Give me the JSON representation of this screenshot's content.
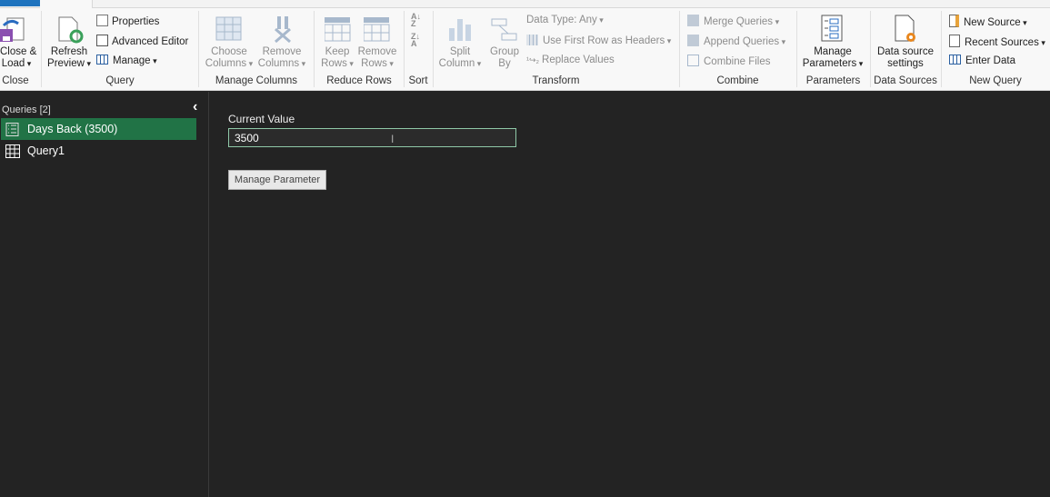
{
  "ribbon": {
    "close": {
      "close_load": "Close &",
      "close_load2": "Load",
      "group": "Close"
    },
    "query": {
      "refresh": "Refresh",
      "refresh2": "Preview",
      "properties": "Properties",
      "advanced_editor": "Advanced Editor",
      "manage": "Manage",
      "group": "Query"
    },
    "manage_columns": {
      "choose": "Choose",
      "choose2": "Columns",
      "remove": "Remove",
      "remove2": "Columns",
      "group": "Manage Columns"
    },
    "reduce_rows": {
      "keep": "Keep",
      "keep2": "Rows",
      "remove": "Remove",
      "remove2": "Rows",
      "group": "Reduce Rows"
    },
    "sort": {
      "group": "Sort"
    },
    "transform": {
      "split": "Split",
      "split2": "Column",
      "group_by": "Group",
      "group_by2": "By",
      "data_type": "Data Type: Any",
      "first_row": "Use First Row as Headers",
      "replace": "Replace Values",
      "group": "Transform"
    },
    "combine": {
      "merge": "Merge Queries",
      "append": "Append Queries",
      "combine_files": "Combine Files",
      "group": "Combine"
    },
    "parameters": {
      "manage": "Manage",
      "manage2": "Parameters",
      "group": "Parameters"
    },
    "data_sources": {
      "settings": "Data source",
      "settings2": "settings",
      "group": "Data Sources"
    },
    "new_query": {
      "new_source": "New Source",
      "recent_sources": "Recent Sources",
      "enter_data": "Enter Data",
      "group": "New Query"
    }
  },
  "sidebar": {
    "header": "Queries [2]",
    "items": [
      {
        "label": "Days Back (3500)",
        "selected": true,
        "icon": "parameter-icon"
      },
      {
        "label": "Query1",
        "selected": false,
        "icon": "table-icon"
      }
    ]
  },
  "main": {
    "current_value_label": "Current Value",
    "current_value": "3500",
    "manage_parameter": "Manage Parameter"
  },
  "colors": {
    "accent": "#217346",
    "tab": "#1e73be"
  }
}
